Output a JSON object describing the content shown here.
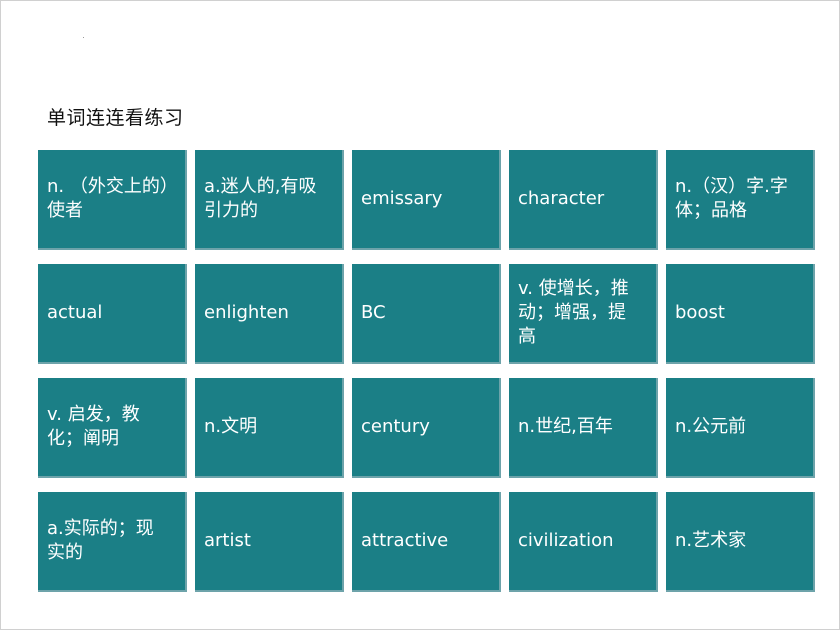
{
  "title": "单词连连看练习",
  "accent_color": "#1b7f86",
  "cards": [
    "n. （外交上的）使者",
    "a.迷人的,有吸引力的",
    "emissary",
    "character",
    "n.（汉）字.字体；品格",
    "actual",
    "enlighten",
    "BC",
    "v. 使增长，推动；增强，提高",
    "boost",
    "v. 启发，教化；阐明",
    "n.文明",
    "century",
    "n.世纪,百年",
    "n.公元前",
    "a.实际的；现实的",
    "artist",
    "attractive",
    "civilization",
    "n.艺术家"
  ]
}
